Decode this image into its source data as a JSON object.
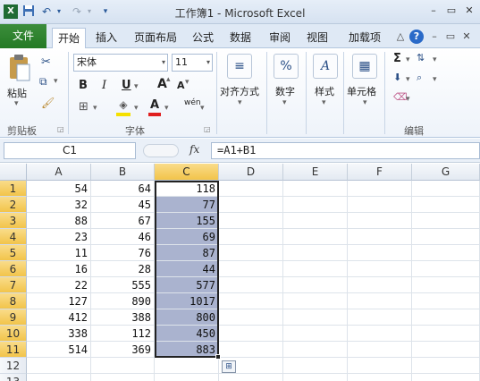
{
  "window": {
    "title": "工作簿1 - Microsoft Excel",
    "qat": {
      "save_icon": "save-icon",
      "undo_icon": "undo-icon",
      "redo_icon": "redo-icon",
      "customize_icon": "customize-qat-icon"
    },
    "controls": {
      "minimize": "–",
      "restore": "▭",
      "close": "✕"
    }
  },
  "tabs": {
    "file": "文件",
    "items": [
      "开始",
      "插入",
      "页面布局",
      "公式",
      "数据",
      "审阅",
      "视图",
      "加载项"
    ],
    "active": "开始",
    "right_icons": {
      "heart": "♡",
      "help": "?",
      "min": "–",
      "restore": "▭",
      "close": "✕"
    }
  },
  "ribbon": {
    "clipboard": {
      "paste_label": "粘贴",
      "group_label": "剪贴板"
    },
    "font": {
      "font_name": "宋体",
      "font_size": "11",
      "bold": "B",
      "italic": "I",
      "underline": "U",
      "grow": "A",
      "shrink": "A",
      "font_color_letter": "A",
      "wen": "wén",
      "group_label": "字体"
    },
    "alignment": {
      "label": "对齐方式"
    },
    "number": {
      "label": "数字",
      "icon": "%"
    },
    "styles": {
      "label": "样式"
    },
    "cells": {
      "label": "单元格"
    },
    "editing": {
      "sum": "Σ",
      "group_label": "编辑"
    }
  },
  "formula_bar": {
    "name_box": "C1",
    "fx": "fx",
    "formula": "=A1+B1"
  },
  "grid": {
    "columns": [
      "A",
      "B",
      "C",
      "D",
      "E",
      "F",
      "G"
    ],
    "selected_column": "C",
    "rows": [
      {
        "n": "1",
        "A": "54",
        "B": "64",
        "C": "118"
      },
      {
        "n": "2",
        "A": "32",
        "B": "45",
        "C": "77"
      },
      {
        "n": "3",
        "A": "88",
        "B": "67",
        "C": "155"
      },
      {
        "n": "4",
        "A": "23",
        "B": "46",
        "C": "69"
      },
      {
        "n": "5",
        "A": "11",
        "B": "76",
        "C": "87"
      },
      {
        "n": "6",
        "A": "16",
        "B": "28",
        "C": "44"
      },
      {
        "n": "7",
        "A": "22",
        "B": "555",
        "C": "577"
      },
      {
        "n": "8",
        "A": "127",
        "B": "890",
        "C": "1017"
      },
      {
        "n": "9",
        "A": "412",
        "B": "388",
        "C": "800"
      },
      {
        "n": "10",
        "A": "338",
        "B": "112",
        "C": "450"
      },
      {
        "n": "11",
        "A": "514",
        "B": "369",
        "C": "883"
      },
      {
        "n": "12",
        "A": "",
        "B": "",
        "C": ""
      },
      {
        "n": "13",
        "A": "",
        "B": "",
        "C": ""
      }
    ],
    "autofill_icon": "autofill-options-icon"
  }
}
